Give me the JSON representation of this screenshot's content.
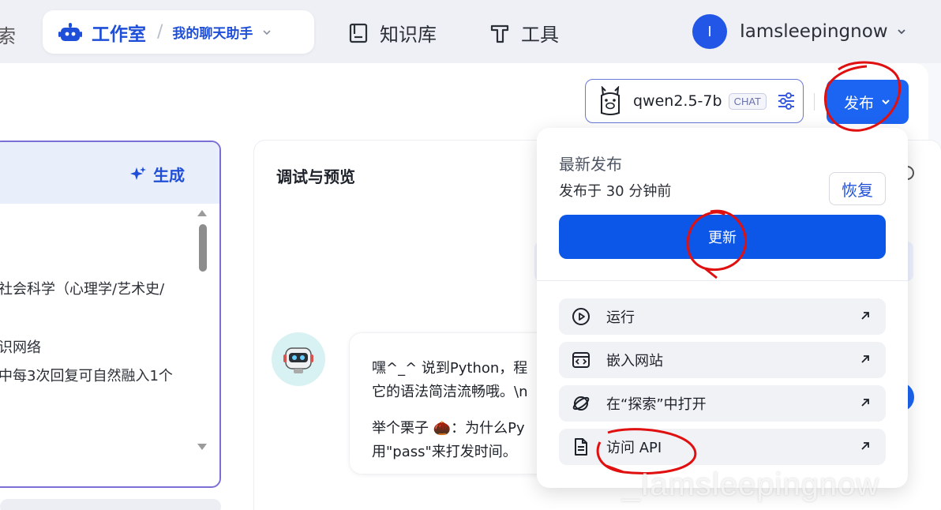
{
  "nav": {
    "cut_text": "索",
    "studio_title": "工作室",
    "bot_name": "我的聊天助手",
    "knowledge": "知识库",
    "tools": "工具",
    "user_initial": "I",
    "user_name": "Iamsleepingnow"
  },
  "model": {
    "name": "qwen2.5-7b",
    "tag": "CHAT"
  },
  "publish": {
    "label": "发布"
  },
  "left_panel": {
    "generate_label": "生成",
    "lines": [
      "社会科学（心理学/艺术史/",
      "识网络",
      "中每3次回复可自然融入1个"
    ]
  },
  "debug": {
    "title": "调试与预览",
    "bubble_lines": [
      "嘿^_^ 说到Python，程",
      "它的语法简洁流畅哦。\\n",
      "举个栗子 🌰：为什么Py",
      "用\"pass\"来打发时间。"
    ]
  },
  "dropdown": {
    "latest_label": "最新发布",
    "published_time": "发布于 30 分钟前",
    "restore_label": "恢复",
    "update_label": "更新",
    "items": [
      {
        "label": "运行",
        "icon": "play-circle-icon"
      },
      {
        "label": "嵌入网站",
        "icon": "embed-icon"
      },
      {
        "label": "在“探索”中打开",
        "icon": "explore-icon"
      },
      {
        "label": "访问 API",
        "icon": "api-doc-icon"
      }
    ]
  },
  "watermark": "_Iamsleepingnow",
  "colors": {
    "primary": "#1c64f2",
    "accent_text": "#1f4fd8",
    "annotation_red": "#e01010"
  }
}
